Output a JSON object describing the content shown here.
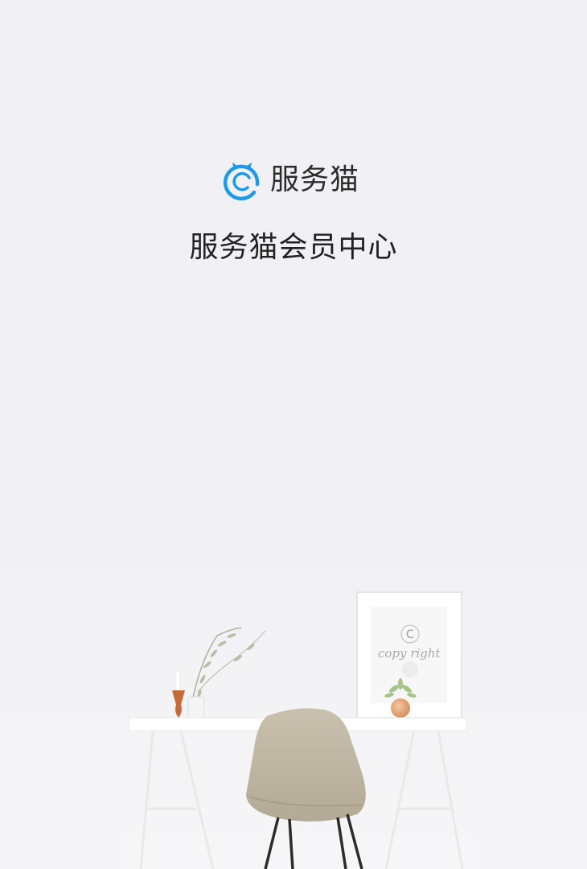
{
  "brand": {
    "name": "服务猫",
    "logo_icon": "cat-c-logo-icon",
    "accent": "#1e9ae8"
  },
  "page": {
    "title": "服务猫会员中心"
  },
  "illustration": {
    "frame_text": "copy right",
    "frame_mark": "C"
  }
}
